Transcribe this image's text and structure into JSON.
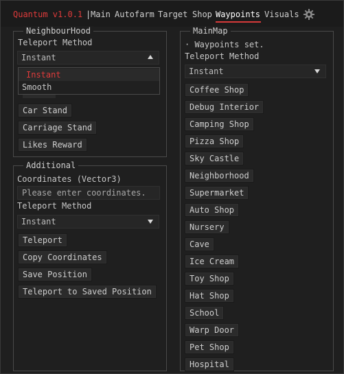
{
  "app": {
    "title": "Quantum v1.0.1",
    "separator": "|"
  },
  "nav": {
    "tabs": [
      "Main",
      "Autofarm",
      "Target",
      "Shop",
      "Waypoints",
      "Visuals"
    ],
    "active": "Waypoints",
    "settings_icon": "gear-icon"
  },
  "neighbourhood": {
    "title": "NeighbourHood",
    "teleport_label": "Teleport Method",
    "dropdown_value": "Instant",
    "options": [
      "Instant",
      "Smooth"
    ],
    "buttons": [
      "Car Stand",
      "Carriage Stand",
      "Likes Reward"
    ]
  },
  "additional": {
    "title": "Additional",
    "coords_label": "Coordinates (Vector3)",
    "coords_placeholder": "Please enter coordinates.",
    "teleport_label": "Teleport Method",
    "dropdown_value": "Instant",
    "buttons": [
      "Teleport",
      "Copy Coordinates",
      "Save Position",
      "Teleport to Saved Position"
    ]
  },
  "mainmap": {
    "title": "MainMap",
    "status": "· Waypoints set.",
    "teleport_label": "Teleport Method",
    "dropdown_value": "Instant",
    "buttons": [
      "Coffee Shop",
      "Debug Interior",
      "Camping Shop",
      "Pizza Shop",
      "Sky Castle",
      "Neighborhood",
      "Supermarket",
      "Auto Shop",
      "Nursery",
      "Cave",
      "Ice Cream",
      "Toy Shop",
      "Hat Shop",
      "School",
      "Warp Door",
      "Pet Shop",
      "Hospital"
    ]
  },
  "colors": {
    "accent": "#e03b3b",
    "background": "#1f1f1f",
    "button": "#2b2b2b"
  }
}
